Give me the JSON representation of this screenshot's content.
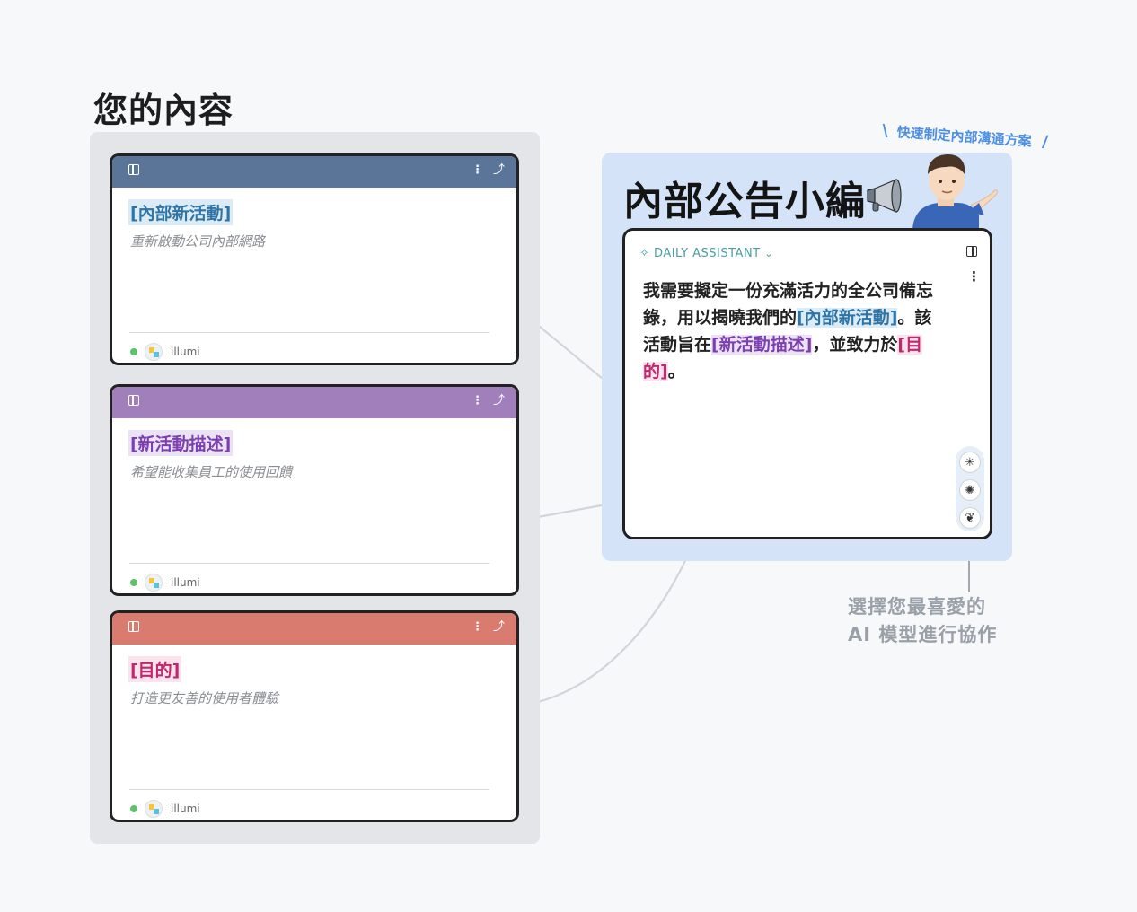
{
  "section_title": "您的內容",
  "cards": [
    {
      "tag": "[內部新活動]",
      "desc": "重新啟動公司內部網路",
      "user": "illumi",
      "header_color": "#5a7598",
      "tag_style": "blue"
    },
    {
      "tag": "[新活動描述]",
      "desc": "希望能收集員工的使用回饋",
      "user": "illumi",
      "header_color": "#a07fba",
      "tag_style": "purple"
    },
    {
      "tag": "[目的]",
      "desc": "打造更友善的使用者體驗",
      "user": "illumi",
      "header_color": "#d97b6e",
      "tag_style": "pink"
    }
  ],
  "tagline": "快速制定內部溝通方案",
  "assistant": {
    "title": "內部公告小編",
    "label": "DAILY ASSISTANT",
    "body": {
      "p1": "我需要擬定一份充滿活力的全公司備忘錄，用以揭曉我們的",
      "t1": "[內部新活動]",
      "p2": "。該活動旨在",
      "t2": "[新活動描述]",
      "p3": "，並致力於",
      "t3": "[目的]",
      "p4": "。"
    },
    "models": [
      "claude-icon",
      "openai-icon",
      "deepseek-icon"
    ]
  },
  "caption": {
    "line1": "選擇您最喜愛的",
    "line2": "AI 模型進行協作"
  }
}
